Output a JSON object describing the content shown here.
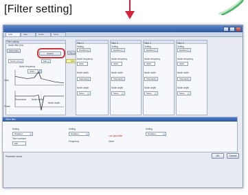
{
  "caption": "[Filter setting]",
  "window": {
    "tabs": [
      "Gain",
      "Filter",
      "Notch",
      "Other"
    ],
    "top_left": {
      "label": "Filter setting",
      "notch_label": "Notch filter (Hz)",
      "buttons": [
        "Notch filter",
        "Search",
        "Manual setting"
      ],
      "highlight_button": "Search",
      "notch_info_a": "Notch info",
      "notch_info_b": "Edit",
      "freq_label": "Notch frequency",
      "freq_value": "1000",
      "graph_label_top": "Gain",
      "graph_label_bottom": "Phase",
      "notch_depth": "Notch depth",
      "notch_width": "Notch width",
      "resonance": "Resonance"
    },
    "columns": [
      {
        "title": "Filter 2",
        "items": [
          "Setting",
          "Disabled",
          "Notch frequency",
          "3000",
          "Notch width",
          "Standard",
          "Notch depth",
          "Slope"
        ]
      },
      {
        "title": "Filter 3",
        "items": [
          "Setting",
          "Disabled",
          "Notch frequency",
          "3000",
          "Notch width",
          "Standard",
          "Notch depth",
          "Slope"
        ]
      },
      {
        "title": "Filter 4",
        "items": [
          "Setting",
          "Disabled",
          "Notch frequency",
          "3000",
          "Notch width",
          "Standard",
          "Notch depth",
          "Slope"
        ]
      },
      {
        "title": "Filter 5",
        "items": [
          "Setting",
          "Disabled",
          "Notch frequency",
          "3000",
          "Notch width",
          "Standard",
          "Notch depth",
          "Slope"
        ]
      }
    ],
    "bottom": {
      "title": "Other filter",
      "left_label": "Setting",
      "left_value": "Disabled",
      "mid_label": "Setting",
      "mid_value": "Disabled",
      "red_text": "Low pass filter",
      "right_label": "Setting",
      "right_value": "Disabled",
      "field_a": "Time constant",
      "field_a_value": "100",
      "field_b": "Frequency",
      "field_c": "Order"
    },
    "status": "Parameter saved",
    "ok": "OK",
    "cancel": "Cancel"
  }
}
